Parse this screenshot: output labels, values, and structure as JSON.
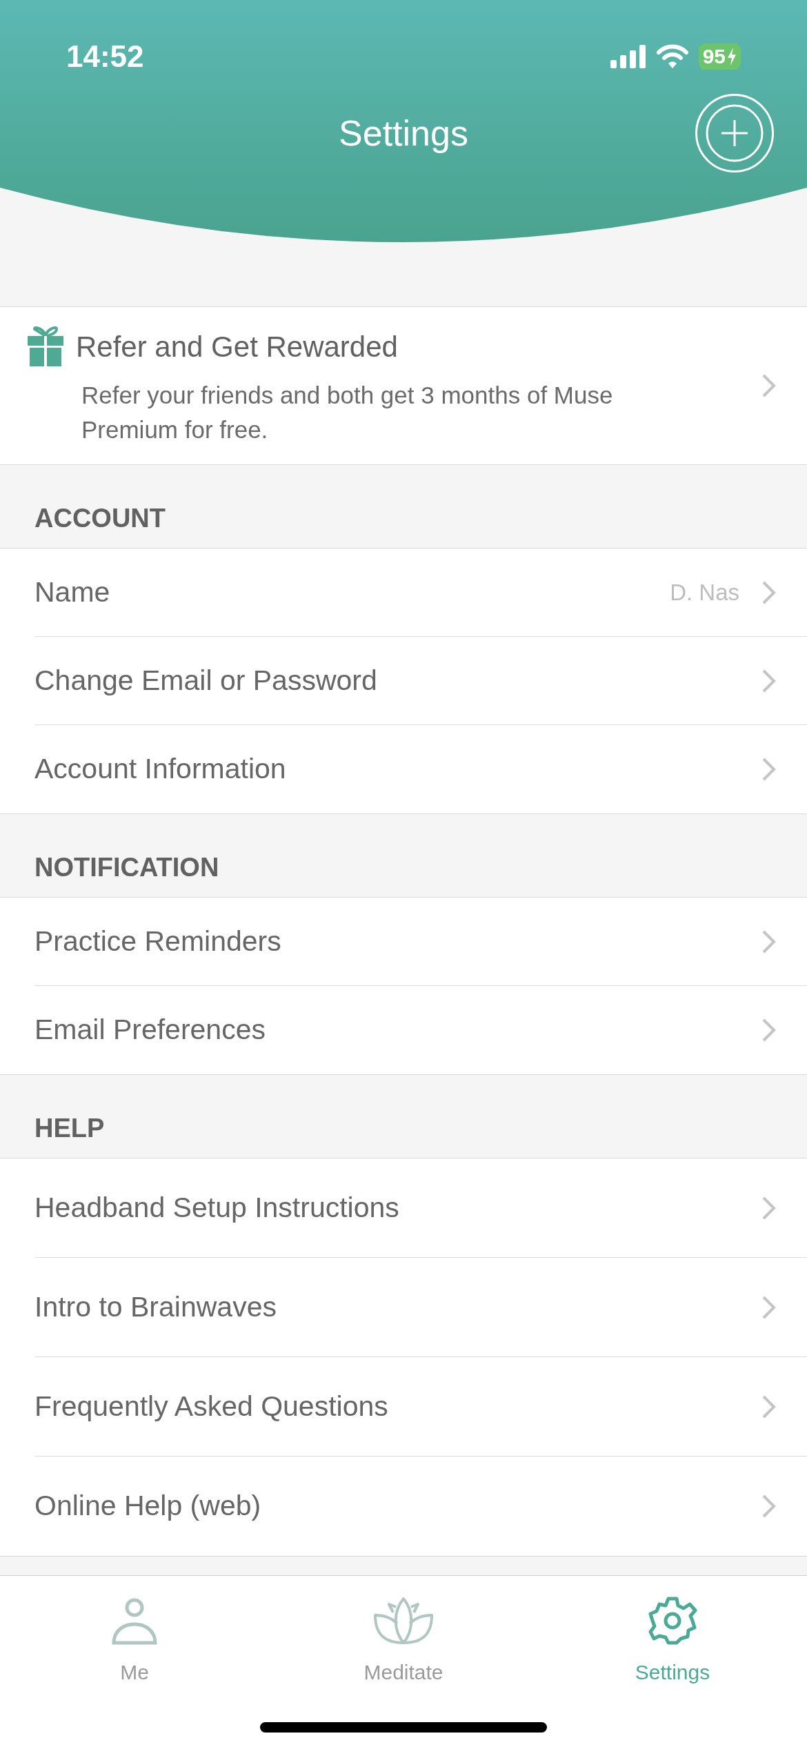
{
  "status_bar": {
    "time": "14:52",
    "battery": "95"
  },
  "title": "Settings",
  "referral": {
    "title": "Refer and Get Rewarded",
    "text": "Refer your friends and both get 3 months of Muse Premium for free."
  },
  "sections": [
    {
      "heading": "ACCOUNT",
      "items": [
        {
          "label": "Name",
          "value": "D. Nas"
        },
        {
          "label": "Change Email or Password"
        },
        {
          "label": "Account Information"
        }
      ]
    },
    {
      "heading": "NOTIFICATION",
      "items": [
        {
          "label": "Practice Reminders"
        },
        {
          "label": "Email Preferences"
        }
      ]
    },
    {
      "heading": "HELP",
      "items": [
        {
          "label": "Headband Setup Instructions"
        },
        {
          "label": "Intro to Brainwaves"
        },
        {
          "label": "Frequently Asked Questions"
        },
        {
          "label": "Online Help (web)"
        }
      ]
    }
  ],
  "tabs": [
    {
      "label": "Me",
      "kind": "person",
      "selected": false
    },
    {
      "label": "Meditate",
      "kind": "lotus",
      "selected": false
    },
    {
      "label": "Settings",
      "kind": "gear",
      "selected": true
    }
  ]
}
